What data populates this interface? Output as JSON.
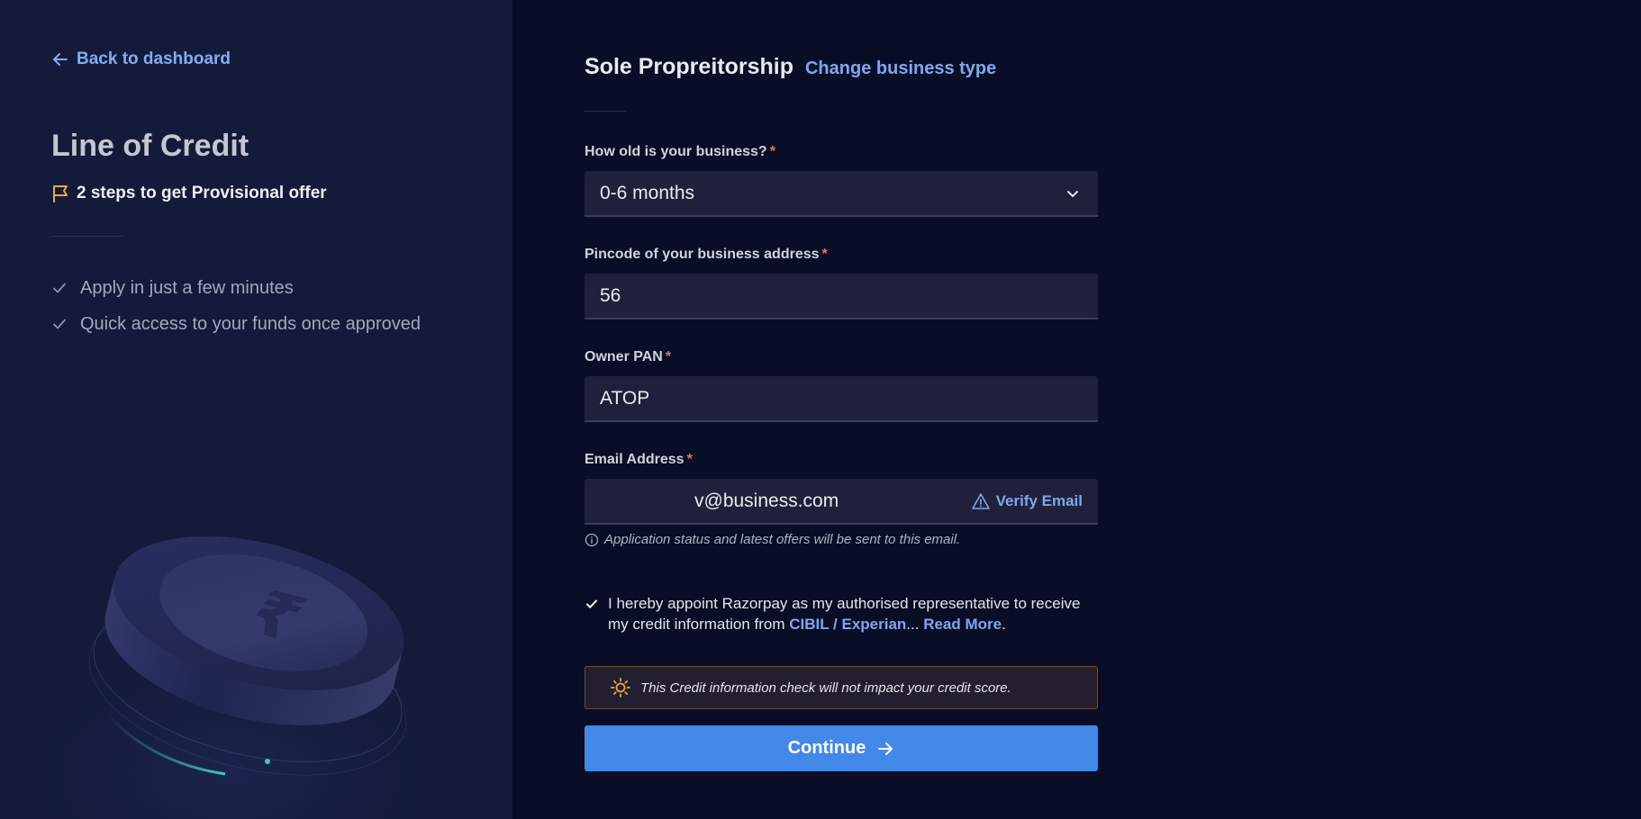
{
  "sidebar": {
    "back_label": "Back to dashboard",
    "title": "Line of Credit",
    "steps_label": "2 steps to get Provisional offer",
    "benefits": [
      "Apply in just a few minutes",
      "Quick access to your funds once approved"
    ],
    "illustration_icon": "rupee-coin-icon"
  },
  "form": {
    "business_type": "Sole Propreitorship",
    "change_business_type_label": "Change business type",
    "fields": {
      "business_age": {
        "label": "How old is your business?",
        "required_marker": "*",
        "value": "0-6 months"
      },
      "pincode": {
        "label": "Pincode of your business address",
        "required_marker": "*",
        "value": "56"
      },
      "owner_pan": {
        "label": "Owner PAN",
        "required_marker": "*",
        "value": "ATOP"
      },
      "email": {
        "label": "Email Address",
        "required_marker": "*",
        "value": "v@business.com",
        "verify_label": "Verify Email",
        "helper_text": "Application status and latest offers will be sent to this email."
      }
    },
    "consent": {
      "checked": true,
      "text_before": "I hereby appoint Razorpay as my authorised representative to receive my credit information from ",
      "bureau_link": "CIBIL / Experian",
      "ellipsis": "... ",
      "read_more": "Read More",
      "period": "."
    },
    "notice_text": "This Credit information check will not impact your credit score.",
    "continue_label": "Continue"
  },
  "colors": {
    "accent": "#4288e9",
    "link": "#7fa8ec",
    "required": "#e5736b",
    "warning": "#f0a640",
    "sidebar_bg": "#131a3a",
    "main_bg": "#090e26"
  }
}
